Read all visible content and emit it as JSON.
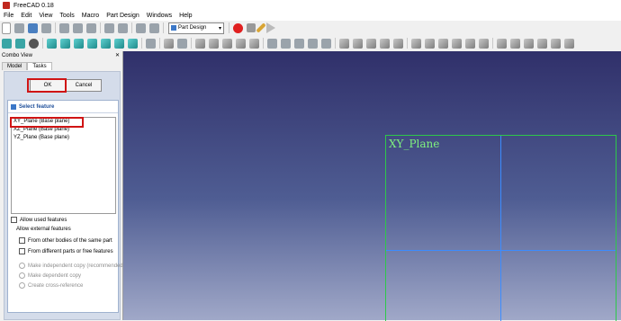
{
  "app": {
    "title": "FreeCAD 0.18"
  },
  "menu": [
    "File",
    "Edit",
    "View",
    "Tools",
    "Macro",
    "Part Design",
    "Windows",
    "Help"
  ],
  "toolbar": {
    "workbench": "Part Design"
  },
  "combo_view": {
    "title": "Combo View",
    "tabs": [
      "Model",
      "Tasks"
    ],
    "buttons": {
      "ok": "OK",
      "cancel": "Cancel"
    },
    "panel_title": "Select feature",
    "features": [
      "XY_Plane (Base plane)",
      "XZ_Plane (Base plane)",
      "YZ_Plane (Base plane)"
    ],
    "allow_used": "Allow used features",
    "allow_external": "Allow external features",
    "from_other_bodies": "From other bodies of the same part",
    "from_different_parts": "From different parts or free features",
    "independent_copy": "Make independent copy (recommended)",
    "dependent_copy": "Make dependent copy",
    "cross_reference": "Create cross-reference"
  },
  "viewport": {
    "plane_label": "XY_Plane"
  },
  "colors": {
    "highlight": "#d01414",
    "plane": "#2ec84a",
    "axis": "#3c8cff"
  }
}
